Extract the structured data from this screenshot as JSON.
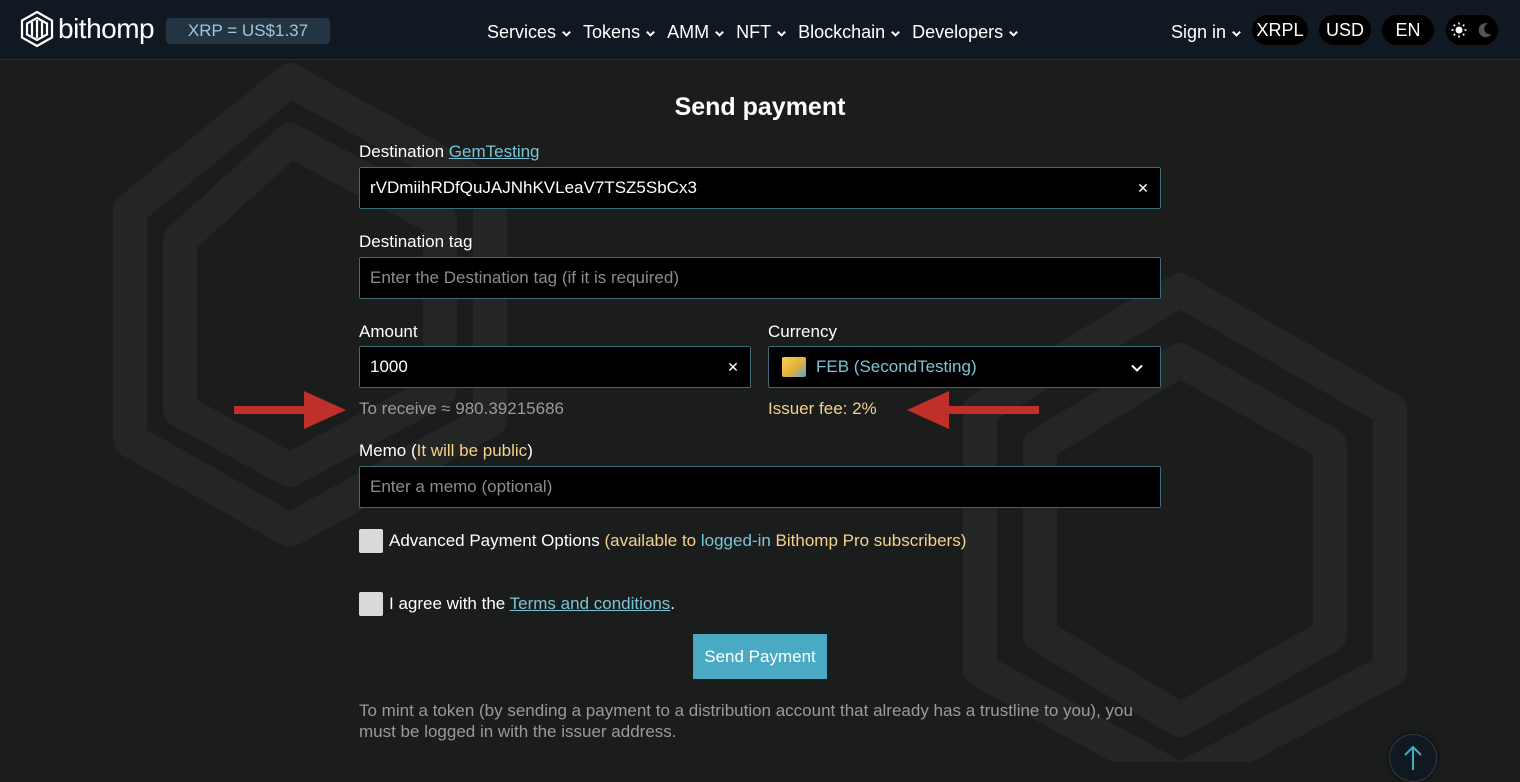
{
  "header": {
    "logo_text": "bithomp",
    "price": "XRP = US$1.37",
    "nav": [
      {
        "label": "Services"
      },
      {
        "label": "Tokens"
      },
      {
        "label": "AMM"
      },
      {
        "label": "NFT"
      },
      {
        "label": "Blockchain"
      },
      {
        "label": "Developers"
      }
    ],
    "sign_in": "Sign in",
    "network": "XRPL",
    "currency": "USD",
    "language": "EN"
  },
  "form": {
    "title": "Send payment",
    "destination": {
      "label": "Destination",
      "name_link": "GemTesting",
      "value": "rVDmiihRDfQuJAJNhKVLeaV7TSZ5SbCx3"
    },
    "destination_tag": {
      "label": "Destination tag",
      "placeholder": "Enter the Destination tag (if it is required)"
    },
    "amount": {
      "label": "Amount",
      "value": "1000",
      "receive_hint": "To receive ≈ 980.39215686"
    },
    "currency": {
      "label": "Currency",
      "selected": "FEB (SecondTesting)",
      "issuer_fee": "Issuer fee: 2%"
    },
    "memo": {
      "label": "Memo",
      "paren_open": " (",
      "warning": "It will be public",
      "paren_close": ")",
      "placeholder": "Enter a memo (optional)"
    },
    "advanced": {
      "label": "Advanced Payment Options",
      "note_start": " (available to ",
      "note_link": "logged-in",
      "note_end": " Bithomp Pro subscribers)"
    },
    "terms": {
      "prefix": "I agree with the ",
      "link": "Terms and conditions",
      "suffix": "."
    },
    "submit_label": "Send Payment",
    "footnote": "To mint a token (by sending a payment to a distribution account that already has a trustline to you), you must be logged in with the issuer address."
  },
  "colors": {
    "accent": "#4aa9c3",
    "link": "#7ac4d6",
    "warning": "#f4d28a",
    "annotation_arrow": "#c0302a"
  }
}
